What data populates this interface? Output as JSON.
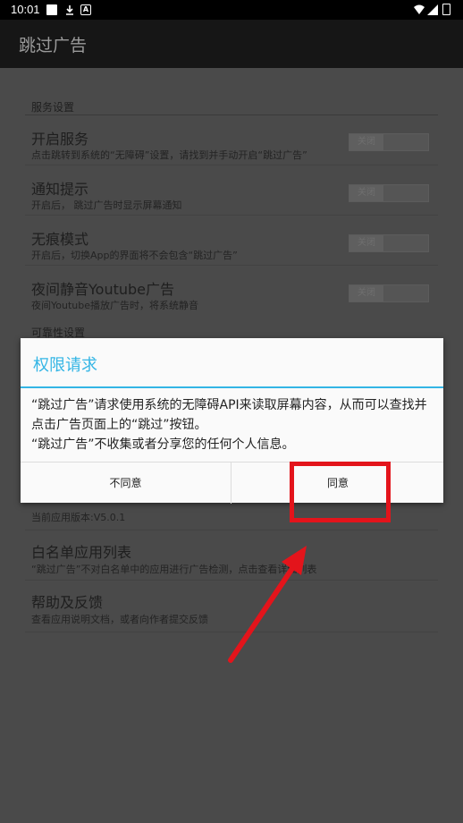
{
  "status_bar": {
    "time": "10:01",
    "icons": [
      "square-icon",
      "download-icon",
      "a-icon",
      "wifi-icon",
      "signal-icon",
      "battery-icon"
    ]
  },
  "app_bar": {
    "title": "跳过广告"
  },
  "settings": {
    "section_service": "服务设置",
    "rows": [
      {
        "title": "开启服务",
        "subtitle": "点击跳转到系统的“无障碍”设置，请找到并手动开启“跳过广告”",
        "toggle": "关闭"
      },
      {
        "title": "通知提示",
        "subtitle": "开启后， 跳过广告时显示屏幕通知",
        "toggle": "关闭"
      },
      {
        "title": "无痕模式",
        "subtitle": "开启后，切换App的界面将不会包含“跳过广告”",
        "toggle": "关闭"
      },
      {
        "title": "夜间静音Youtube广告",
        "subtitle": "夜间Youtube播放广告时，将系统静音",
        "toggle": "关闭"
      }
    ],
    "section_reliability": "可靠性设置",
    "version": {
      "subtitle": "当前应用版本:V5.0.1"
    },
    "whitelist": {
      "title": "白名单应用列表",
      "subtitle": "“跳过广告”不对白名单中的应用进行广告检测，点击查看详细列表"
    },
    "help": {
      "title": "帮助及反馈",
      "subtitle": "查看应用说明文档，或者向作者提交反馈"
    }
  },
  "dialog": {
    "title": "权限请求",
    "message_line1": "“跳过广告”请求使用系统的无障碍API来读取屏幕内容，从而可以查找并点击广告页面上的“跳过”按钮。",
    "message_line2": "“跳过广告”不收集或者分享您的任何个人信息。",
    "disagree_label": "不同意",
    "agree_label": "同意"
  },
  "colors": {
    "accent": "#33b5e5",
    "annotation": "#e3141b"
  }
}
